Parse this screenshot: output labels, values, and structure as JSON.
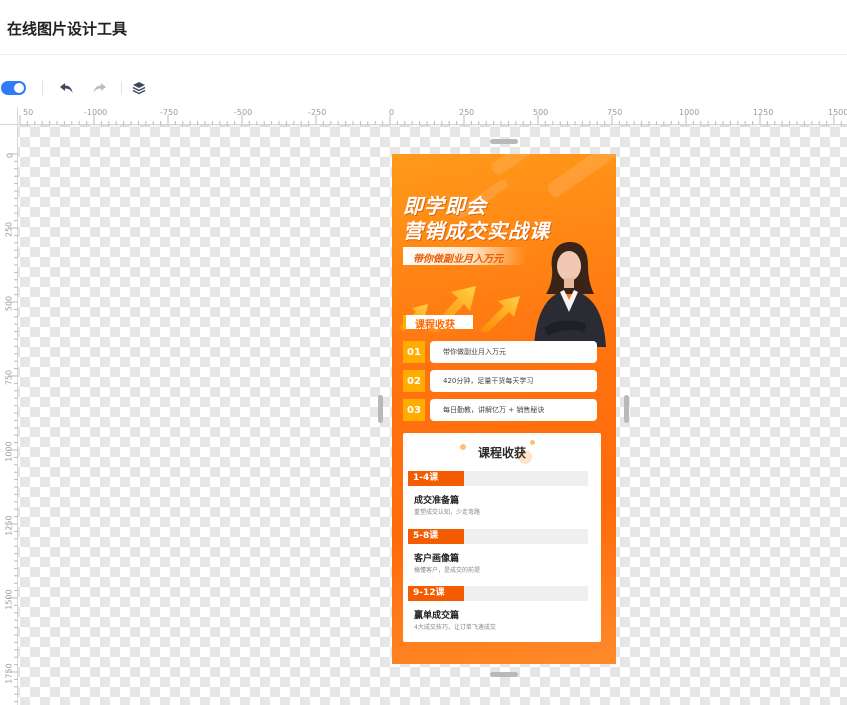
{
  "app": {
    "title": "在线图片设计工具"
  },
  "toolbar": {
    "toggle_icon": "toggle-switch",
    "undo_icon": "undo-arrow",
    "redo_icon": "redo-arrow",
    "layers_icon": "layers-stack"
  },
  "ruler": {
    "top_labels": [
      "50",
      "-1000",
      "-750",
      "-500",
      "-250",
      "0",
      "250",
      "500",
      "750",
      "1000",
      "1250",
      "1500"
    ],
    "left_labels": [
      "0",
      "250",
      "500",
      "750",
      "1000",
      "1250",
      "1500",
      "1750"
    ]
  },
  "poster": {
    "headline_line1": "即学即会",
    "headline_line2": "营销成交实战课",
    "banner": "带你做副业月入万元",
    "section_label": "课程收获",
    "benefits": [
      {
        "num": "01",
        "text": "带你做副业月入万元"
      },
      {
        "num": "02",
        "text": "420分钟，足量干货每天学习"
      },
      {
        "num": "03",
        "text": "每日勤教，讲解亿万 + 销售秘诀"
      }
    ],
    "card": {
      "title": "课程收获",
      "lessons": [
        {
          "tag": "1-4课",
          "name": "成交准备篇",
          "desc": "重塑成交认知，少走弯路"
        },
        {
          "tag": "5-8课",
          "name": "客户画像篇",
          "desc": "搞懂客户，是成交的前提"
        },
        {
          "tag": "9-12课",
          "name": "赢单成交篇",
          "desc": "4大成交技巧，让订单飞速成交"
        }
      ]
    }
  },
  "colors": {
    "accent": "#2f7cf6",
    "poster_orange": "#ff7410",
    "tag_red": "#f35c00",
    "num_yellow": "#ffae00"
  }
}
